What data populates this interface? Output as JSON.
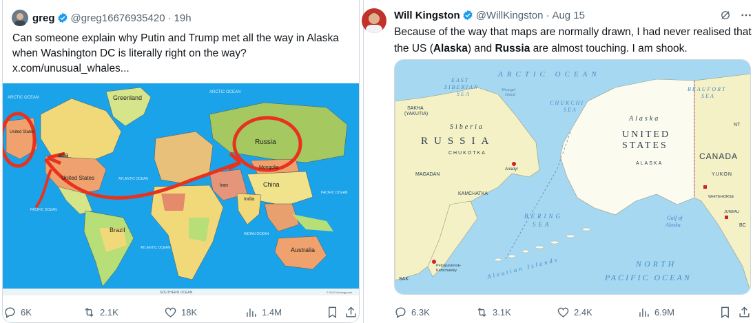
{
  "quoted_tweet": {
    "author_name": "greg",
    "handle": "@greg16676935420",
    "separator": "·",
    "time": "19h",
    "text_lines": [
      "Can someone explain why Putin and Trump met all the way in Alaska",
      "when Washington DC is literally right on the way?",
      "x.com/unusual_whales..."
    ],
    "map_labels": {
      "greenland": "Greenland",
      "russia": "Russia",
      "mongolia": "Mongolia",
      "china": "China",
      "india": "India",
      "iran": "Iran",
      "brazil": "Brazil",
      "australia": "Australia",
      "united_states": "United States",
      "canada_partial": "ada",
      "alaska_us": "United States",
      "arctic_ocean_left": "ARCTIC OCEAN",
      "arctic_ocean_right": "ARCTIC OCEAN",
      "atlantic": "ATLANTIC OCEAN",
      "atlantic_south": "ATLANTIC OCEAN",
      "pacific_left": "PACIFIC OCEAN",
      "pacific_right": "PACIFIC OCEAN",
      "indian": "INDIAN OCEAN",
      "southern": "SOUTHERN OCEAN",
      "copyright": "© 2022 Geology.com"
    },
    "metrics": {
      "replies": "6K",
      "reposts": "2.1K",
      "likes": "18K",
      "views": "1.4M"
    }
  },
  "main_tweet": {
    "author_name": "Will Kingston",
    "handle": "@WillKingston",
    "separator": "·",
    "date": "Aug 15",
    "text_line1": "Because of the way that maps are normally drawn, I had never realised that",
    "text_line2_parts": [
      "the US (",
      "Alaska",
      ") and ",
      "Russia",
      " are almost touching. I am shook."
    ],
    "map_labels": {
      "arctic_ocean": "ARCTIC OCEAN",
      "east_siberian_sea": [
        "EAST",
        "SIBERIAN",
        "SEA"
      ],
      "chukchi_sea": [
        "CHUKCHI",
        "SEA"
      ],
      "beaufort_sea": [
        "BEAUFORT",
        "SEA"
      ],
      "sakha": [
        "SAKHA",
        "(YAKUTIA)"
      ],
      "siberia": "Siberia",
      "russia": "RUSSIA",
      "chukotka": "CHUKOTKA",
      "alaska_italic": "Alaska",
      "united_states": [
        "UNITED",
        "STATES"
      ],
      "alaska_caps": "ALASKA",
      "canada": "CANADA",
      "yukon": "YUKON",
      "nt": "NT",
      "bc": "BC",
      "magadan": "MAGADAN",
      "kamchatka": "KAMCHATKA",
      "anadyr": "Anadyr",
      "bering_sea": [
        "BERING",
        "SEA"
      ],
      "north_pacific": [
        "NORTH",
        "PACIFIC OCEAN"
      ],
      "aleutian": "Aleutian Islands",
      "whitehorse": "WHITEHORSE",
      "juneau": "JUNEAU",
      "petropavlovsk": [
        "Petropavlovsk-",
        "Kamchatsky"
      ],
      "sak": "SAK",
      "gulf_of_alaska": [
        "Gulf of",
        "Alaska"
      ],
      "wrangel": [
        "Wrangel",
        "Island"
      ]
    },
    "metrics": {
      "replies": "6.3K",
      "reposts": "3.1K",
      "likes": "2.4K",
      "views": "6.9M"
    }
  },
  "colors": {
    "verified": "#1d9bf0",
    "ocean_left": "#1aa3e8",
    "ocean_right": "#a6d8f2",
    "land_right": "#f5f1c6",
    "us_right": "#fbfbf0",
    "annotation_red": "#e8321e"
  }
}
